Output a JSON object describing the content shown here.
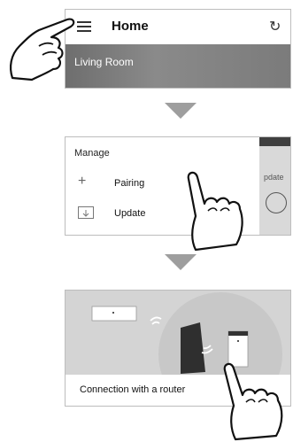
{
  "panel1": {
    "title": "Home",
    "room": "Living Room",
    "icons": [
      "menu-icon",
      "refresh-icon"
    ]
  },
  "panel2": {
    "heading": "Manage",
    "items": [
      {
        "icon": "plus-icon",
        "label": "Pairing"
      },
      {
        "icon": "download-icon",
        "label": "Update"
      }
    ],
    "side_label": "pdate"
  },
  "panel3": {
    "caption": "Connection with a router"
  }
}
